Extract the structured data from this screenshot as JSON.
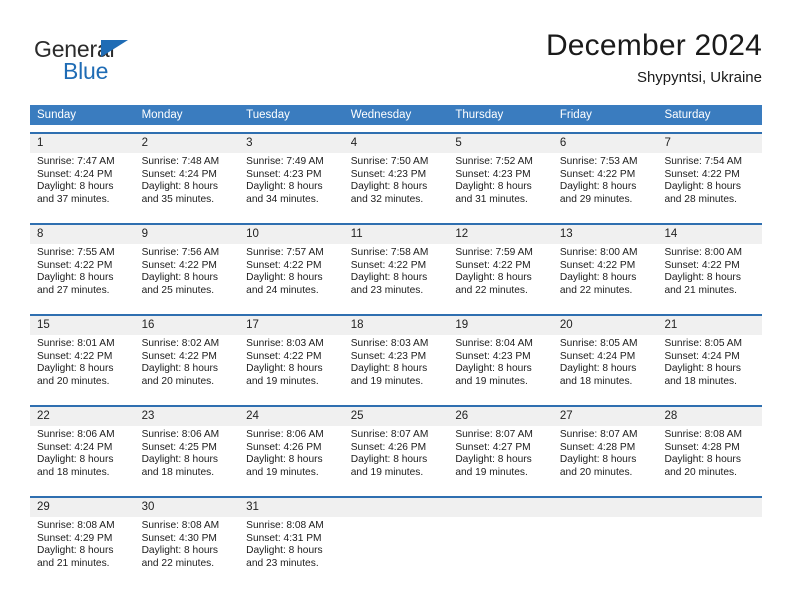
{
  "brand": {
    "name_top": "General",
    "name_bottom": "Blue",
    "color_primary": "#1f6cb5",
    "color_text": "#2b2b2b"
  },
  "header": {
    "title": "December 2024",
    "subtitle": "Shypyntsi, Ukraine"
  },
  "theme": {
    "header_row_bg": "#3a7cbf",
    "week_divider": "#2f6fb0",
    "day_number_bg": "#f0f0f0",
    "page_bg": "#ffffff"
  },
  "weekdays": [
    "Sunday",
    "Monday",
    "Tuesday",
    "Wednesday",
    "Thursday",
    "Friday",
    "Saturday"
  ],
  "labels": {
    "sunrise_prefix": "Sunrise: ",
    "sunset_prefix": "Sunset: ",
    "daylight_prefix": "Daylight: "
  },
  "weeks": [
    [
      {
        "day": "1",
        "sunrise": "Sunrise: 7:47 AM",
        "sunset": "Sunset: 4:24 PM",
        "daylight1": "Daylight: 8 hours",
        "daylight2": "and 37 minutes."
      },
      {
        "day": "2",
        "sunrise": "Sunrise: 7:48 AM",
        "sunset": "Sunset: 4:24 PM",
        "daylight1": "Daylight: 8 hours",
        "daylight2": "and 35 minutes."
      },
      {
        "day": "3",
        "sunrise": "Sunrise: 7:49 AM",
        "sunset": "Sunset: 4:23 PM",
        "daylight1": "Daylight: 8 hours",
        "daylight2": "and 34 minutes."
      },
      {
        "day": "4",
        "sunrise": "Sunrise: 7:50 AM",
        "sunset": "Sunset: 4:23 PM",
        "daylight1": "Daylight: 8 hours",
        "daylight2": "and 32 minutes."
      },
      {
        "day": "5",
        "sunrise": "Sunrise: 7:52 AM",
        "sunset": "Sunset: 4:23 PM",
        "daylight1": "Daylight: 8 hours",
        "daylight2": "and 31 minutes."
      },
      {
        "day": "6",
        "sunrise": "Sunrise: 7:53 AM",
        "sunset": "Sunset: 4:22 PM",
        "daylight1": "Daylight: 8 hours",
        "daylight2": "and 29 minutes."
      },
      {
        "day": "7",
        "sunrise": "Sunrise: 7:54 AM",
        "sunset": "Sunset: 4:22 PM",
        "daylight1": "Daylight: 8 hours",
        "daylight2": "and 28 minutes."
      }
    ],
    [
      {
        "day": "8",
        "sunrise": "Sunrise: 7:55 AM",
        "sunset": "Sunset: 4:22 PM",
        "daylight1": "Daylight: 8 hours",
        "daylight2": "and 27 minutes."
      },
      {
        "day": "9",
        "sunrise": "Sunrise: 7:56 AM",
        "sunset": "Sunset: 4:22 PM",
        "daylight1": "Daylight: 8 hours",
        "daylight2": "and 25 minutes."
      },
      {
        "day": "10",
        "sunrise": "Sunrise: 7:57 AM",
        "sunset": "Sunset: 4:22 PM",
        "daylight1": "Daylight: 8 hours",
        "daylight2": "and 24 minutes."
      },
      {
        "day": "11",
        "sunrise": "Sunrise: 7:58 AM",
        "sunset": "Sunset: 4:22 PM",
        "daylight1": "Daylight: 8 hours",
        "daylight2": "and 23 minutes."
      },
      {
        "day": "12",
        "sunrise": "Sunrise: 7:59 AM",
        "sunset": "Sunset: 4:22 PM",
        "daylight1": "Daylight: 8 hours",
        "daylight2": "and 22 minutes."
      },
      {
        "day": "13",
        "sunrise": "Sunrise: 8:00 AM",
        "sunset": "Sunset: 4:22 PM",
        "daylight1": "Daylight: 8 hours",
        "daylight2": "and 22 minutes."
      },
      {
        "day": "14",
        "sunrise": "Sunrise: 8:00 AM",
        "sunset": "Sunset: 4:22 PM",
        "daylight1": "Daylight: 8 hours",
        "daylight2": "and 21 minutes."
      }
    ],
    [
      {
        "day": "15",
        "sunrise": "Sunrise: 8:01 AM",
        "sunset": "Sunset: 4:22 PM",
        "daylight1": "Daylight: 8 hours",
        "daylight2": "and 20 minutes."
      },
      {
        "day": "16",
        "sunrise": "Sunrise: 8:02 AM",
        "sunset": "Sunset: 4:22 PM",
        "daylight1": "Daylight: 8 hours",
        "daylight2": "and 20 minutes."
      },
      {
        "day": "17",
        "sunrise": "Sunrise: 8:03 AM",
        "sunset": "Sunset: 4:22 PM",
        "daylight1": "Daylight: 8 hours",
        "daylight2": "and 19 minutes."
      },
      {
        "day": "18",
        "sunrise": "Sunrise: 8:03 AM",
        "sunset": "Sunset: 4:23 PM",
        "daylight1": "Daylight: 8 hours",
        "daylight2": "and 19 minutes."
      },
      {
        "day": "19",
        "sunrise": "Sunrise: 8:04 AM",
        "sunset": "Sunset: 4:23 PM",
        "daylight1": "Daylight: 8 hours",
        "daylight2": "and 19 minutes."
      },
      {
        "day": "20",
        "sunrise": "Sunrise: 8:05 AM",
        "sunset": "Sunset: 4:24 PM",
        "daylight1": "Daylight: 8 hours",
        "daylight2": "and 18 minutes."
      },
      {
        "day": "21",
        "sunrise": "Sunrise: 8:05 AM",
        "sunset": "Sunset: 4:24 PM",
        "daylight1": "Daylight: 8 hours",
        "daylight2": "and 18 minutes."
      }
    ],
    [
      {
        "day": "22",
        "sunrise": "Sunrise: 8:06 AM",
        "sunset": "Sunset: 4:24 PM",
        "daylight1": "Daylight: 8 hours",
        "daylight2": "and 18 minutes."
      },
      {
        "day": "23",
        "sunrise": "Sunrise: 8:06 AM",
        "sunset": "Sunset: 4:25 PM",
        "daylight1": "Daylight: 8 hours",
        "daylight2": "and 18 minutes."
      },
      {
        "day": "24",
        "sunrise": "Sunrise: 8:06 AM",
        "sunset": "Sunset: 4:26 PM",
        "daylight1": "Daylight: 8 hours",
        "daylight2": "and 19 minutes."
      },
      {
        "day": "25",
        "sunrise": "Sunrise: 8:07 AM",
        "sunset": "Sunset: 4:26 PM",
        "daylight1": "Daylight: 8 hours",
        "daylight2": "and 19 minutes."
      },
      {
        "day": "26",
        "sunrise": "Sunrise: 8:07 AM",
        "sunset": "Sunset: 4:27 PM",
        "daylight1": "Daylight: 8 hours",
        "daylight2": "and 19 minutes."
      },
      {
        "day": "27",
        "sunrise": "Sunrise: 8:07 AM",
        "sunset": "Sunset: 4:28 PM",
        "daylight1": "Daylight: 8 hours",
        "daylight2": "and 20 minutes."
      },
      {
        "day": "28",
        "sunrise": "Sunrise: 8:08 AM",
        "sunset": "Sunset: 4:28 PM",
        "daylight1": "Daylight: 8 hours",
        "daylight2": "and 20 minutes."
      }
    ],
    [
      {
        "day": "29",
        "sunrise": "Sunrise: 8:08 AM",
        "sunset": "Sunset: 4:29 PM",
        "daylight1": "Daylight: 8 hours",
        "daylight2": "and 21 minutes."
      },
      {
        "day": "30",
        "sunrise": "Sunrise: 8:08 AM",
        "sunset": "Sunset: 4:30 PM",
        "daylight1": "Daylight: 8 hours",
        "daylight2": "and 22 minutes."
      },
      {
        "day": "31",
        "sunrise": "Sunrise: 8:08 AM",
        "sunset": "Sunset: 4:31 PM",
        "daylight1": "Daylight: 8 hours",
        "daylight2": "and 23 minutes."
      },
      {
        "day": "",
        "sunrise": "",
        "sunset": "",
        "daylight1": "",
        "daylight2": ""
      },
      {
        "day": "",
        "sunrise": "",
        "sunset": "",
        "daylight1": "",
        "daylight2": ""
      },
      {
        "day": "",
        "sunrise": "",
        "sunset": "",
        "daylight1": "",
        "daylight2": ""
      },
      {
        "day": "",
        "sunrise": "",
        "sunset": "",
        "daylight1": "",
        "daylight2": ""
      }
    ]
  ]
}
